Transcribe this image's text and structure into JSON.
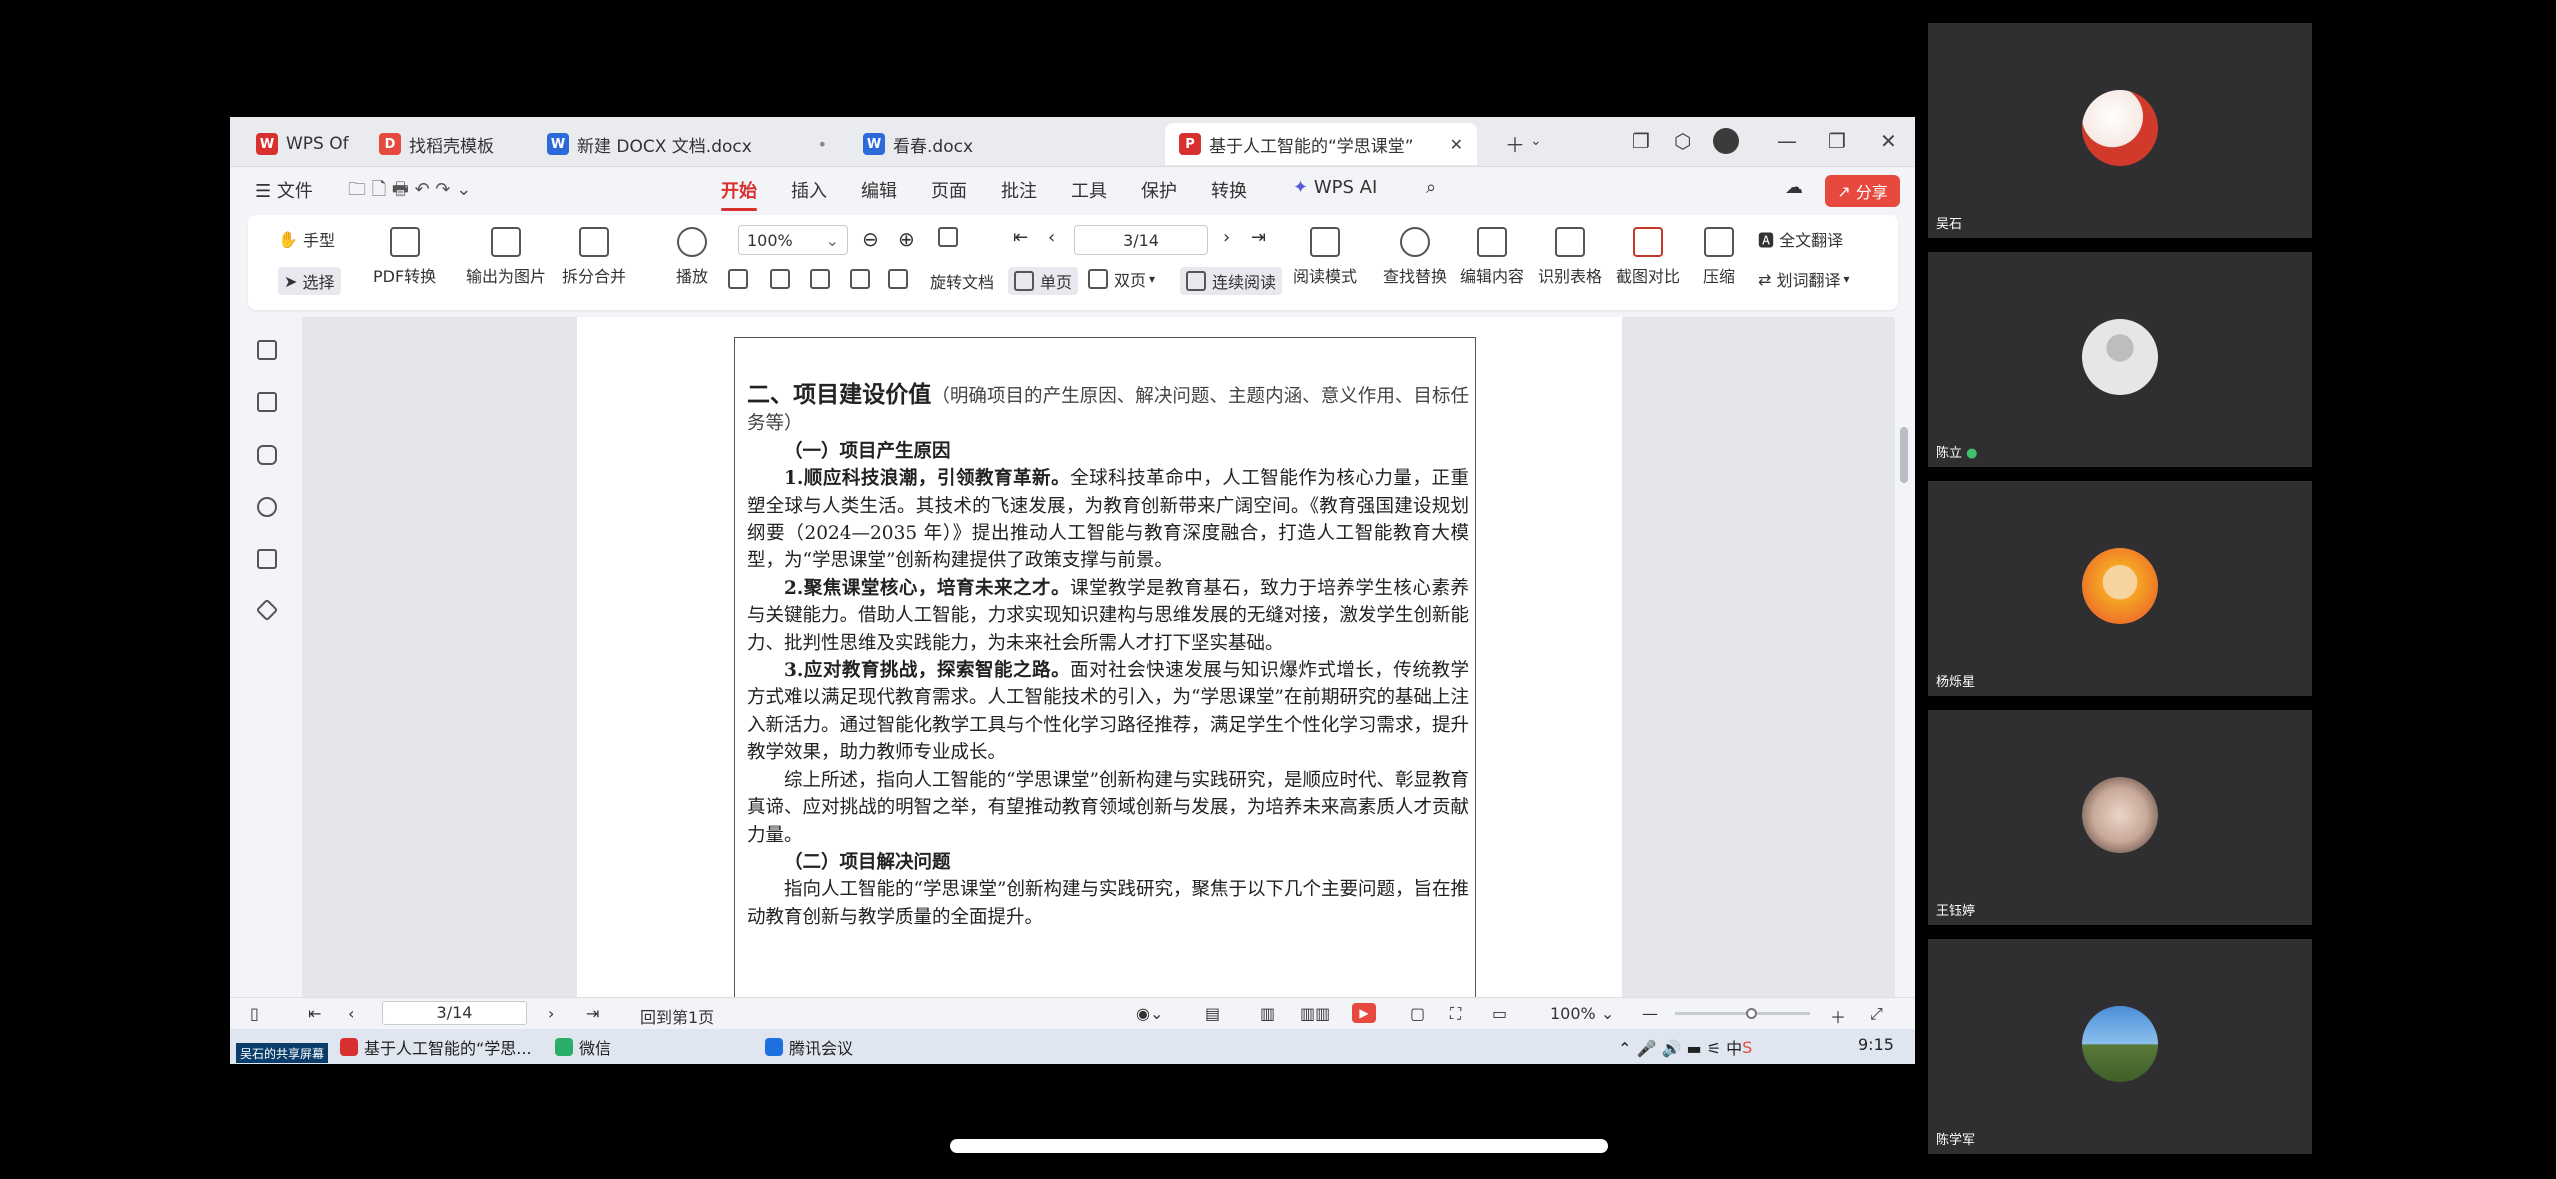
{
  "tabs": [
    {
      "label": "WPS Of",
      "icon": "wps-logo-icon",
      "color": "#d8302f"
    },
    {
      "label": "找稻壳模板",
      "icon": "docer-icon",
      "color": "#e8493e"
    },
    {
      "label": "新建 DOCX 文档.docx",
      "icon": "word-doc-icon",
      "color": "#2b6ad8"
    },
    {
      "label": "看春.docx",
      "icon": "word-doc-icon",
      "color": "#2b6ad8"
    },
    {
      "label": "基于人工智能的“学思课堂”",
      "icon": "pdf-icon",
      "color": "#d8302f"
    }
  ],
  "menu": {
    "file": "文件",
    "items": [
      "开始",
      "插入",
      "编辑",
      "页面",
      "批注",
      "工具",
      "保护",
      "转换"
    ],
    "ai": "WPS AI",
    "share": "分享"
  },
  "toolbar": {
    "hand": "手型",
    "select": "选择",
    "pdf_convert": "PDF转换",
    "export_image": "输出为图片",
    "split_merge": "拆分合并",
    "play": "播放",
    "zoom": "100%",
    "page": "3/14",
    "rotate": "旋转文档",
    "single": "单页",
    "double": "双页",
    "continuous": "连续阅读",
    "read_mode": "阅读模式",
    "find_replace": "查找替换",
    "edit_content": "编辑内容",
    "recognize_table": "识别表格",
    "screenshot_compare": "截图对比",
    "compress": "压缩",
    "full_translate": "全文翻译",
    "word_translate": "划词翻译"
  },
  "document": {
    "heading": "二、项目建设价值",
    "heading_note": "（明确项目的产生原因、解决问题、主题内涵、意义作用、目标任务等）",
    "sub1": "（一）项目产生原因",
    "p1_bold": "1.顺应科技浪潮，引领教育革新。",
    "p1": "全球科技革命中，人工智能作为核心力量，正重塑全球与人类生活。其技术的飞速发展，为教育创新带来广阔空间。《教育强国建设规划纲要（2024—2035 年）》提出推动人工智能与教育深度融合，打造人工智能教育大模型，为“学思课堂”创新构建提供了政策支撑与前景。",
    "p2_bold": "2.聚焦课堂核心，培育未来之才。",
    "p2": "课堂教学是教育基石，致力于培养学生核心素养与关键能力。借助人工智能，力求实现知识建构与思维发展的无缝对接，激发学生创新能力、批判性思维及实践能力，为未来社会所需人才打下坚实基础。",
    "p3_bold": "3.应对教育挑战，探索智能之路。",
    "p3": "面对社会快速发展与知识爆炸式增长，传统教学方式难以满足现代教育需求。人工智能技术的引入，为“学思课堂”在前期研究的基础上注入新活力。通过智能化教学工具与个性化学习路径推荐，满足学生个性化学习需求，提升教学效果，助力教师专业成长。",
    "p4": "综上所述，指向人工智能的“学思课堂”创新构建与实践研究，是顺应时代、彰显教育真谛、应对挑战的明智之举，有望推动教育领域创新与发展，为培养未来高素质人才贡献力量。",
    "sub2": "（二）项目解决问题",
    "p5": "指向人工智能的“学思课堂”创新构建与实践研究，聚焦于以下几个主要问题，旨在推动教育创新与教学质量的全面提升。"
  },
  "status": {
    "page": "3/14",
    "back": "回到第1页",
    "zoom": "100%"
  },
  "taskbar": {
    "share_label": "吴石的共享屏幕",
    "items": [
      "基于人工智能的“学思...",
      "微信",
      "腾讯会议"
    ],
    "time": "9:15"
  },
  "participants": [
    {
      "name": "吴石"
    },
    {
      "name": "陈立"
    },
    {
      "name": "杨烁星"
    },
    {
      "name": "王钰婷"
    },
    {
      "name": "陈学军"
    }
  ]
}
